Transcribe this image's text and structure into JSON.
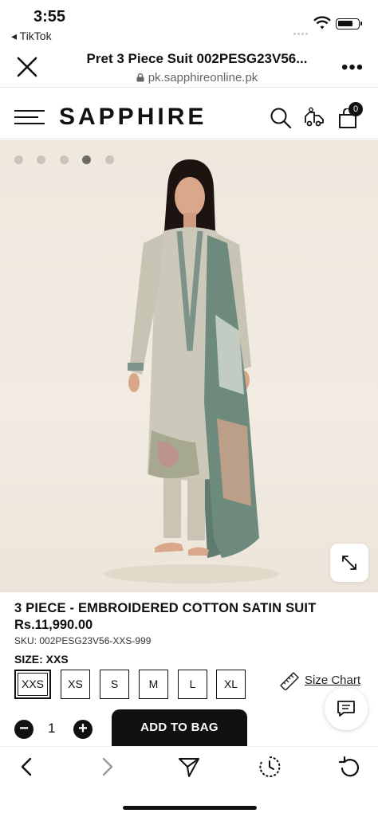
{
  "status": {
    "time": "3:55",
    "back_app": "◂ TikTok"
  },
  "browser": {
    "title": "Pret 3 Piece Suit 002PESG23V56...",
    "url": "pk.sapphireonline.pk",
    "more": "•••"
  },
  "site": {
    "logo": "SAPPHIRE",
    "bag_count": "0"
  },
  "gallery": {
    "dot_count": 5,
    "active_index": 3
  },
  "product": {
    "title": "3 PIECE - EMBROIDERED COTTON SATIN SUIT",
    "price": "Rs.11,990.00",
    "sku": "SKU: 002PESG23V56-XXS-999",
    "size_label": "SIZE: XXS",
    "sizes": [
      "XXS",
      "XS",
      "S",
      "M",
      "L",
      "XL"
    ],
    "selected_size": "XXS",
    "size_chart": "Size Chart",
    "quantity": "1",
    "minus": "−",
    "plus": "+",
    "add_to_bag": "ADD TO BAG"
  },
  "icons": {
    "close": "close-icon",
    "lock": "lock-icon",
    "menu": "hamburger-icon",
    "search": "search-icon",
    "delivery": "delivery-truck-icon",
    "bag": "shopping-bag-icon",
    "expand": "expand-icon",
    "ruler": "ruler-icon",
    "chat": "chat-icon",
    "back": "back-arrow-icon",
    "forward": "forward-arrow-icon",
    "share": "send-icon",
    "history": "history-icon",
    "reload": "reload-icon"
  }
}
